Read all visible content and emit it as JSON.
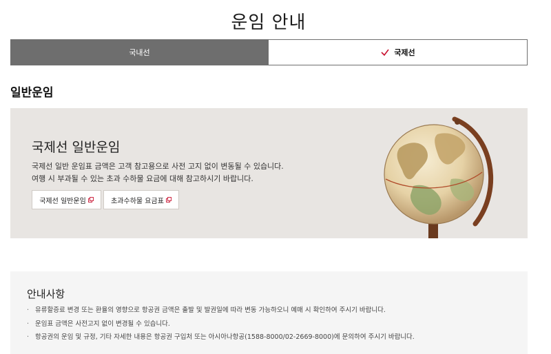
{
  "header": {
    "title": "운임 안내"
  },
  "tabs": [
    {
      "label": "국내선",
      "active": false
    },
    {
      "label": "국제선",
      "active": true
    }
  ],
  "section": {
    "title": "일반운임"
  },
  "fare_box": {
    "heading": "국제선 일반운임",
    "desc_lines": [
      "국제선 일반 운임표 금액은 고객 참고용으로 사전 고지 없이 변동될 수 있습니다.",
      "여행 시 부과될 수 있는 초과 수하물 요금에 대해 참고하시기 바랍니다."
    ],
    "buttons": [
      {
        "label": "국제선 일반운임",
        "icon": "external-link-icon"
      },
      {
        "label": "초과수하물 요금표",
        "icon": "external-link-icon"
      }
    ],
    "image": "globe"
  },
  "notice": {
    "title": "안내사항",
    "items": [
      "유류할증료 변경 또는 환율의 영향으로 항공권 금액은 출발 및 발권일에 따라 변동 가능하오니 예매 시 확인하여 주시기 바랍니다.",
      "운임표 금액은 사전고지 없이 변경될 수 있습니다.",
      "항공권의 운임 및 규정, 기타 자세한 내용은 항공권 구입처 또는 아시아나항공(1588-8000/02-2669-8000)에 문의하여 주시기 바랍니다."
    ]
  },
  "colors": {
    "tab_inactive": "#6e6e6e",
    "check_mark": "#c8102e",
    "fare_box_bg": "#e8e5e2",
    "notice_bg": "#f5f5f5"
  }
}
